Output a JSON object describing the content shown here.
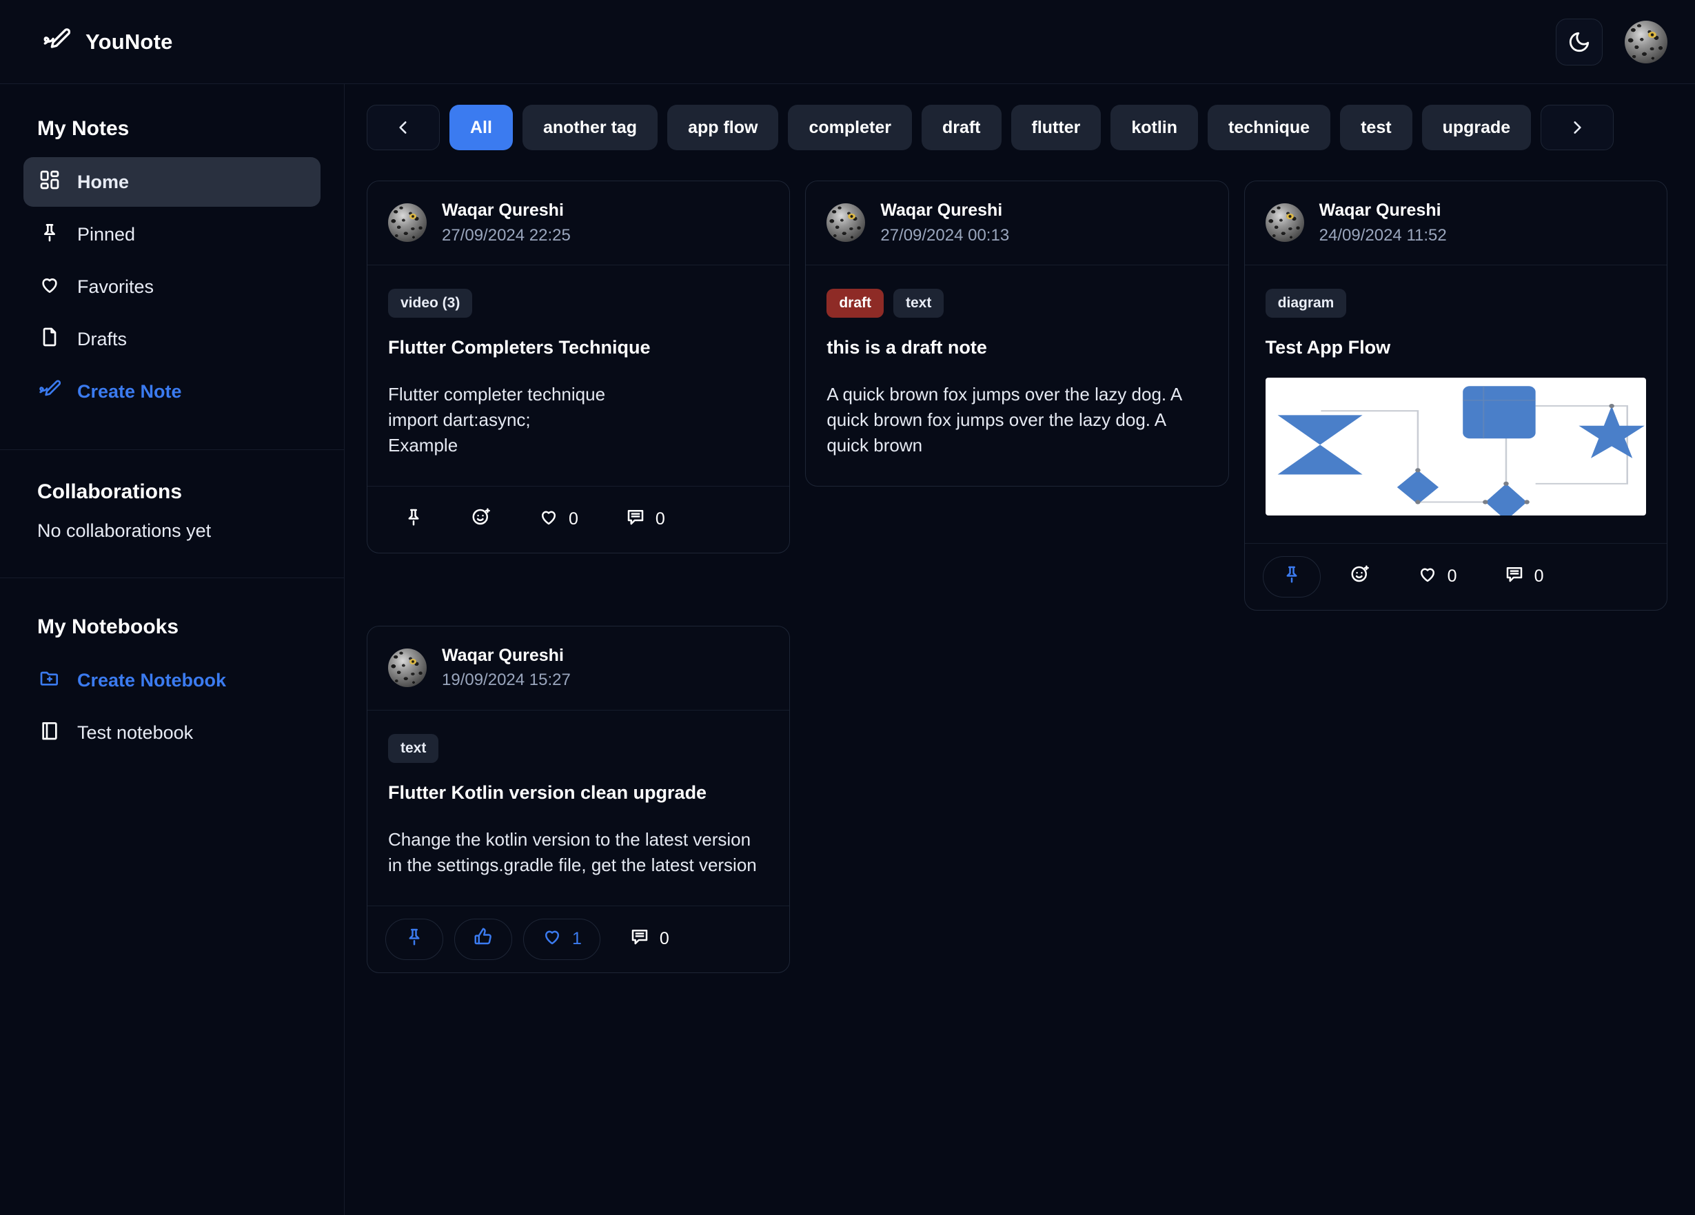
{
  "app": {
    "brand": "YouNote",
    "logo_icon": "pencil-note-icon",
    "theme_toggle_icon": "moon-icon",
    "avatar_icon": "user-avatar"
  },
  "sidebar": {
    "notes_title": "My Notes",
    "items": [
      {
        "label": "Home",
        "icon": "dashboard-grid-icon",
        "active": true
      },
      {
        "label": "Pinned",
        "icon": "pin-icon",
        "active": false
      },
      {
        "label": "Favorites",
        "icon": "heart-icon",
        "active": false
      },
      {
        "label": "Drafts",
        "icon": "file-icon",
        "active": false
      },
      {
        "label": "Create Note",
        "icon": "pencil-note-icon",
        "active": false,
        "accent": true
      }
    ],
    "collab_title": "Collaborations",
    "collab_empty": "No collaborations yet",
    "notebooks_title": "My Notebooks",
    "create_notebook": "Create Notebook",
    "create_notebook_icon": "folder-plus-icon",
    "notebook_item": "Test notebook",
    "notebook_icon": "book-icon"
  },
  "tagbar": {
    "prev_icon": "chevron-left-icon",
    "next_icon": "chevron-right-icon",
    "tags": [
      {
        "label": "All",
        "active": true
      },
      {
        "label": "another tag",
        "active": false
      },
      {
        "label": "app flow",
        "active": false
      },
      {
        "label": "completer",
        "active": false
      },
      {
        "label": "draft",
        "active": false
      },
      {
        "label": "flutter",
        "active": false
      },
      {
        "label": "kotlin",
        "active": false
      },
      {
        "label": "technique",
        "active": false
      },
      {
        "label": "test",
        "active": false
      },
      {
        "label": "upgrade",
        "active": false
      }
    ]
  },
  "colors": {
    "accent": "#3b7bf0",
    "background": "#060a16",
    "card_border": "#1e2636",
    "badge_bg": "#1d2433",
    "badge_draft_bg": "#8e2b26",
    "muted_text": "#9aa6bd"
  },
  "notes": [
    {
      "author": "Waqar Qureshi",
      "date": "27/09/2024 22:25",
      "badges": [
        {
          "label": "video (3)",
          "kind": "normal"
        }
      ],
      "title": "Flutter Completers Technique",
      "text": "Flutter completer technique\nimport dart:async;\nExample",
      "media": null,
      "actions": [
        {
          "icon": "pin-icon",
          "label": "",
          "active": false,
          "pill": false
        },
        {
          "icon": "emoji-add-icon",
          "label": "",
          "active": false,
          "pill": false
        },
        {
          "icon": "heart-icon",
          "label": "0",
          "active": false,
          "pill": false
        },
        {
          "icon": "comment-icon",
          "label": "0",
          "active": false,
          "pill": false
        }
      ]
    },
    {
      "author": "Waqar Qureshi",
      "date": "27/09/2024 00:13",
      "badges": [
        {
          "label": "draft",
          "kind": "draft"
        },
        {
          "label": "text",
          "kind": "normal"
        }
      ],
      "title": "this is a draft note",
      "text": "A quick brown fox jumps over the lazy dog. A quick brown fox jumps over the lazy dog. A quick brown",
      "media": null,
      "actions": []
    },
    {
      "author": "Waqar Qureshi",
      "date": "24/09/2024 11:52",
      "badges": [
        {
          "label": "diagram",
          "kind": "normal"
        }
      ],
      "title": "Test App Flow",
      "text": "",
      "media": "flow-diagram",
      "actions": [
        {
          "icon": "pin-icon",
          "label": "",
          "active": true,
          "pill": true
        },
        {
          "icon": "emoji-add-icon",
          "label": "",
          "active": false,
          "pill": false
        },
        {
          "icon": "heart-icon",
          "label": "0",
          "active": false,
          "pill": false
        },
        {
          "icon": "comment-icon",
          "label": "0",
          "active": false,
          "pill": false
        }
      ]
    },
    {
      "author": "Waqar Qureshi",
      "date": "19/09/2024 15:27",
      "badges": [
        {
          "label": "text",
          "kind": "normal"
        }
      ],
      "title": "Flutter Kotlin version clean upgrade",
      "text": "Change the kotlin version to the latest version in the settings.gradle file, get the latest version",
      "media": null,
      "actions": [
        {
          "icon": "pin-icon",
          "label": "",
          "active": true,
          "pill": true
        },
        {
          "icon": "thumbs-up-icon",
          "label": "",
          "active": true,
          "pill": true
        },
        {
          "icon": "heart-icon",
          "label": "1",
          "active": true,
          "pill": true
        },
        {
          "icon": "comment-icon",
          "label": "0",
          "active": false,
          "pill": false
        }
      ]
    }
  ]
}
